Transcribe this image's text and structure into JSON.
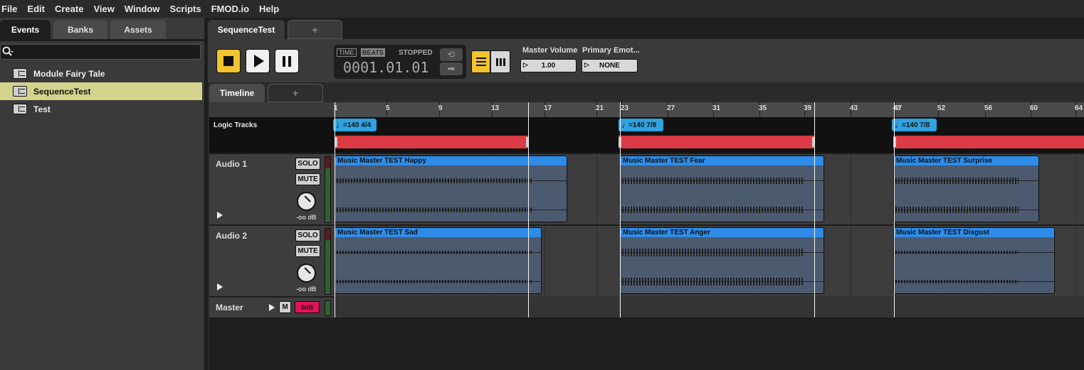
{
  "menu": [
    "File",
    "Edit",
    "Create",
    "View",
    "Window",
    "Scripts",
    "FMOD.io",
    "Help"
  ],
  "left_tabs": [
    "Events",
    "Banks",
    "Assets"
  ],
  "events": [
    "Module Fairy Tale",
    "SequenceTest",
    "Test"
  ],
  "selected_event": "SequenceTest",
  "editor_tab": "SequenceTest",
  "add_tab": "+",
  "transport": {
    "time_label": "TIME",
    "beats_label": "BEATS",
    "status": "STOPPED",
    "position": "0001.01.01"
  },
  "params": {
    "master_volume_label": "Master Volume",
    "master_volume_value": "1.00",
    "emotion_label": "Primary Emot...",
    "emotion_value": "NONE"
  },
  "subtabs": [
    "Timeline",
    "+"
  ],
  "ruler": [
    "1",
    "5",
    "9",
    "13",
    "17",
    "21",
    "23",
    "27",
    "31",
    "35",
    "39",
    "43",
    "47",
    "52",
    "56",
    "60",
    "64"
  ],
  "ruler_overlap": "43",
  "logic_tracks_label": "Logic Tracks",
  "markers": [
    "=140 4/4",
    "=140 7/8",
    "=140 7/8"
  ],
  "tracks": [
    {
      "name": "Audio 1",
      "solo": "SOLO",
      "mute": "MUTE",
      "db": "-oo dB",
      "instruments": [
        "Music Master TEST Happy",
        "Music Master TEST Fear",
        "Music Master TEST Surprise"
      ]
    },
    {
      "name": "Audio 2",
      "solo": "SOLO",
      "mute": "MUTE",
      "db": "-oo dB",
      "instruments": [
        "Music Master TEST Sad",
        "Music Master TEST Anger",
        "Music Master TEST Disgust"
      ]
    }
  ],
  "master": {
    "name": "Master",
    "m": "M",
    "vol": "0dB"
  },
  "colors": {
    "accent": "#f3c42b",
    "instrument": "#2e8ce8",
    "region": "#dc3a44",
    "selected": "#d3d38d",
    "marker": "#2fa3e0"
  }
}
